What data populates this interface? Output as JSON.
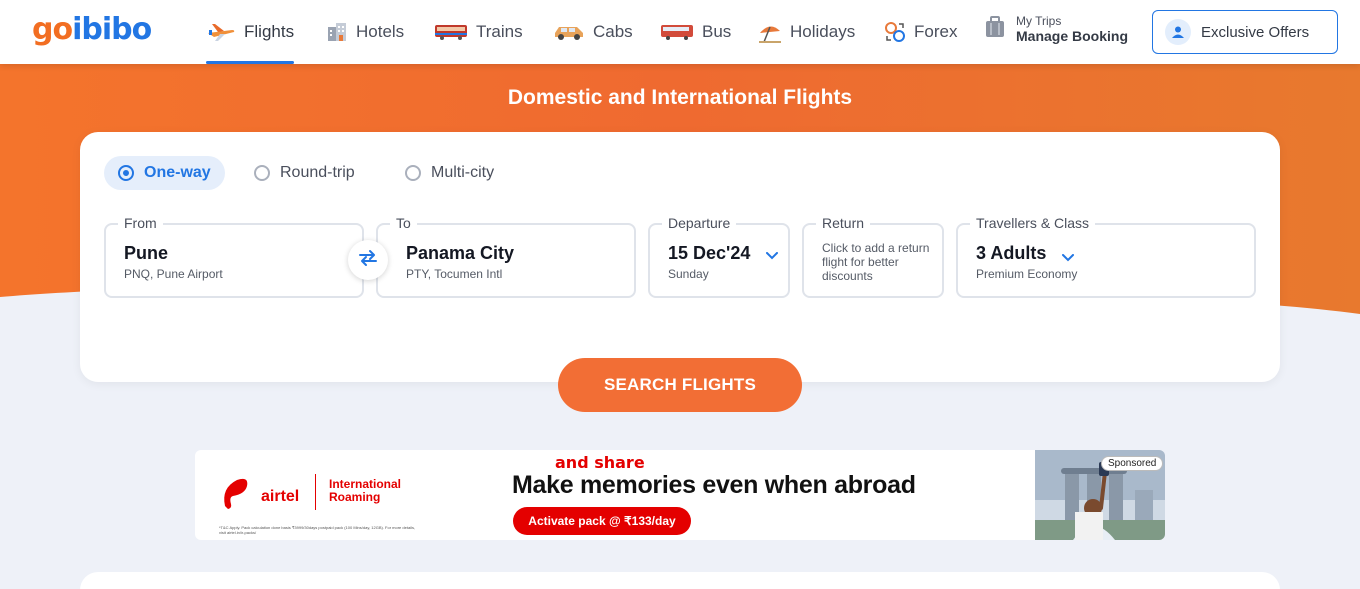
{
  "brand": {
    "go": "go",
    "ibibo": "ibibo"
  },
  "nav": {
    "items": [
      {
        "label": "Flights",
        "icon": "flight-icon",
        "active": true
      },
      {
        "label": "Hotels",
        "icon": "hotel-icon"
      },
      {
        "label": "Trains",
        "icon": "train-icon"
      },
      {
        "label": "Cabs",
        "icon": "cab-icon"
      },
      {
        "label": "Bus",
        "icon": "bus-icon"
      },
      {
        "label": "Holidays",
        "icon": "holidays-icon"
      },
      {
        "label": "Forex",
        "icon": "forex-icon"
      }
    ],
    "my_trips": {
      "small": "My Trips",
      "big": "Manage Booking"
    },
    "offers_label": "Exclusive Offers"
  },
  "hero": {
    "title": "Domestic and International Flights"
  },
  "search": {
    "trip_types": [
      "One-way",
      "Round-trip",
      "Multi-city"
    ],
    "selected_trip_type": "One-way",
    "from": {
      "label": "From",
      "city": "Pune",
      "airport": "PNQ, Pune Airport"
    },
    "to": {
      "label": "To",
      "city": "Panama City",
      "airport": "PTY, Tocumen Intl"
    },
    "departure": {
      "label": "Departure",
      "date": "15 Dec'24",
      "day": "Sunday"
    },
    "return": {
      "label": "Return",
      "note": "Click to add a return flight for better discounts"
    },
    "travellers": {
      "label": "Travellers & Class",
      "count": "3 Adults",
      "class": "Premium Economy"
    },
    "button_label": "SEARCH FLIGHTS"
  },
  "ad": {
    "brand": "airtel",
    "product": "International Roaming",
    "share_text": "and share",
    "headline": "Make memories even when abroad",
    "cta": "Activate pack @ ₹133/day",
    "fine_print": "*T&C Apply. Pack calculation done basis ₹3999/30days postpaid pack (100 Mins/day, 12GB). For more details, visit airtel.in/ir-packs/",
    "sponsored": "Sponsored"
  },
  "colors": {
    "brand_orange": "#f26e22",
    "brand_blue": "#2276e3",
    "airtel_red": "#e40000"
  }
}
